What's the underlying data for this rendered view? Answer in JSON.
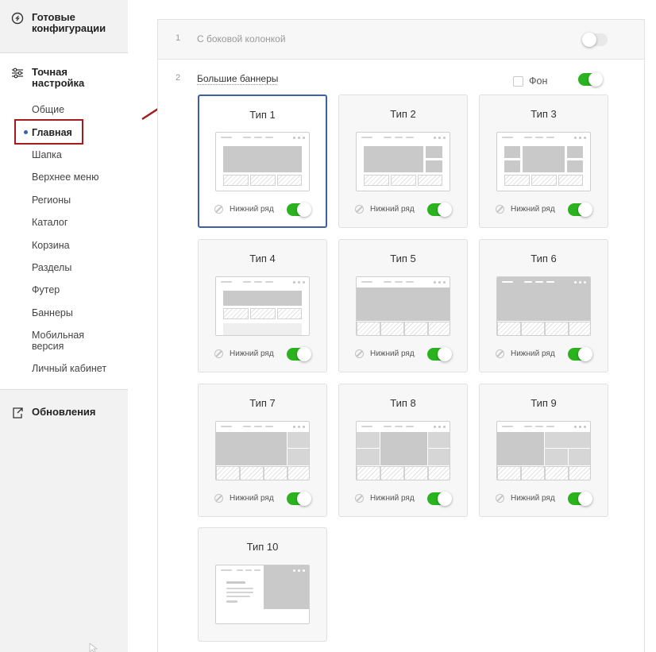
{
  "sidebar": {
    "ready_configs": "Готовые конфигурации",
    "fine_tuning": "Точная настройка",
    "items": [
      "Общие",
      "Главная",
      "Шапка",
      "Верхнее меню",
      "Регионы",
      "Каталог",
      "Корзина",
      "Разделы",
      "Футер",
      "Баннеры",
      "Мобильная версия",
      "Личный кабинет"
    ],
    "updates": "Обновления"
  },
  "rows": [
    {
      "num": "1",
      "label": "С боковой колонкой",
      "enabled": false
    },
    {
      "num": "2",
      "label": "Большие баннеры",
      "enabled": true
    }
  ],
  "fon": {
    "label": "Фон",
    "checked": false
  },
  "cards": [
    {
      "title": "Тип 1",
      "footer": "Нижний ряд",
      "toggle": true,
      "selected": true
    },
    {
      "title": "Тип 2",
      "footer": "Нижний ряд",
      "toggle": true,
      "selected": false
    },
    {
      "title": "Тип 3",
      "footer": "Нижний ряд",
      "toggle": true,
      "selected": false
    },
    {
      "title": "Тип 4",
      "footer": "Нижний ряд",
      "toggle": true,
      "selected": false
    },
    {
      "title": "Тип 5",
      "footer": "Нижний ряд",
      "toggle": true,
      "selected": false
    },
    {
      "title": "Тип 6",
      "footer": "Нижний ряд",
      "toggle": true,
      "selected": false
    },
    {
      "title": "Тип 7",
      "footer": "Нижний ряд",
      "toggle": true,
      "selected": false
    },
    {
      "title": "Тип 8",
      "footer": "Нижний ряд",
      "toggle": true,
      "selected": false
    },
    {
      "title": "Тип 9",
      "footer": "Нижний ряд",
      "toggle": true,
      "selected": false
    },
    {
      "title": "Тип 10"
    }
  ],
  "colors": {
    "accent": "#2bb31f",
    "selected_border": "#3f5ea8",
    "highlight": "#a51c1c"
  }
}
